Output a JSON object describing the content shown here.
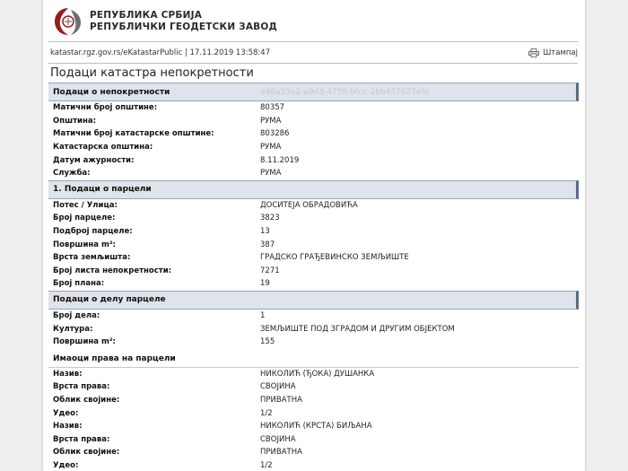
{
  "header": {
    "agency_line1": "РЕПУБЛИКА СРБИЈА",
    "agency_line2": "РЕПУБЛИЧКИ ГЕОДЕТСКИ ЗАВОД"
  },
  "urlbar": {
    "url_and_time": "katastar.rgz.gov.rs/eKatastarPublic | 17.11.2019 13:58:47",
    "print_label": "Штампај"
  },
  "page_title": "Подаци катастра непокретности",
  "property_section": {
    "title": "Подаци о непокретности",
    "guid": "a46a53a2-a9d3-4759-bfcc-2bb437627efe",
    "rows": [
      {
        "label": "Матични број општине:",
        "value": "80357"
      },
      {
        "label": "Општина:",
        "value": "РУМА"
      },
      {
        "label": "Матични број катастарске општине:",
        "value": "803286"
      },
      {
        "label": "Катастарска општина:",
        "value": "РУМА"
      },
      {
        "label": "Датум ажурности:",
        "value": "8.11.2019"
      },
      {
        "label": "Служба:",
        "value": "РУМА"
      }
    ]
  },
  "parcel_section": {
    "title": "1. Подаци о парцели",
    "rows": [
      {
        "label": "Потес / Улица:",
        "value": "ДОСИТЕЈА ОБРАДОВИЋА"
      },
      {
        "label": "Број парцеле:",
        "value": "3823"
      },
      {
        "label": "Подброј парцеле:",
        "value": "13"
      },
      {
        "label": "Површина m²:",
        "value": "387"
      },
      {
        "label": "Врста земљишта:",
        "value": "ГРАДСКО ГРАЂЕВИНСКО ЗЕМЉИШТЕ"
      },
      {
        "label": "Број листа непокретности:",
        "value": "7271"
      },
      {
        "label": "Број плана:",
        "value": "19"
      }
    ]
  },
  "part_section": {
    "title": "Подаци о делу парцеле",
    "rows": [
      {
        "label": "Број дела:",
        "value": "1"
      },
      {
        "label": "Култура:",
        "value": "ЗЕМЉИШТЕ ПОД ЗГРАДОМ И ДРУГИМ ОБЈЕКТОМ"
      },
      {
        "label": "Површина m²:",
        "value": "155"
      }
    ]
  },
  "rights_section": {
    "title": "Имаоци права на парцели",
    "rows": [
      {
        "label": "Назив:",
        "value": "НИКОЛИЋ (ЂОКА) ДУШАНКА"
      },
      {
        "label": "Врста права:",
        "value": "СВОЈИНА"
      },
      {
        "label": "Облик својине:",
        "value": "ПРИВАТНА"
      },
      {
        "label": "Удео:",
        "value": "1/2"
      },
      {
        "label": "Назив:",
        "value": "НИКОЛИЋ (КРСТА) БИЉАНА"
      },
      {
        "label": "Врста права:",
        "value": "СВОЈИНА"
      },
      {
        "label": "Облик својине:",
        "value": "ПРИВАТНА"
      },
      {
        "label": "Удео:",
        "value": "1/2"
      }
    ]
  }
}
